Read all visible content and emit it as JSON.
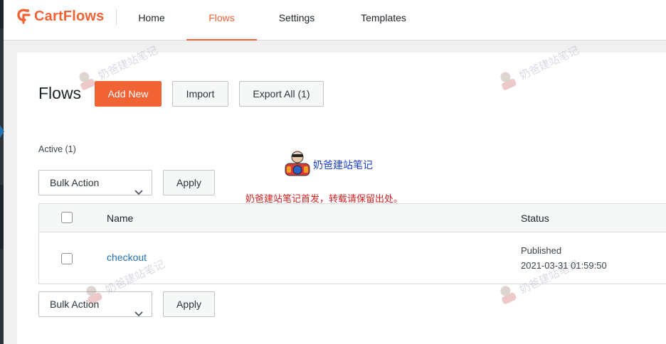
{
  "brand": {
    "name": "CartFlows",
    "color": "#f16334"
  },
  "nav": {
    "tabs": [
      {
        "label": "Home"
      },
      {
        "label": "Flows",
        "active": true
      },
      {
        "label": "Settings"
      },
      {
        "label": "Templates"
      }
    ]
  },
  "page": {
    "title": "Flows",
    "add_new_label": "Add New",
    "import_label": "Import",
    "export_label": "Export All (1)",
    "active_count_label": "Active (1)"
  },
  "bulk": {
    "selected_action": "Bulk Action",
    "apply_label": "Apply"
  },
  "table": {
    "columns": [
      "Name",
      "Status"
    ],
    "rows": [
      {
        "name": "checkout",
        "status": "Published",
        "date": "2021-03-31 01:59:50"
      }
    ]
  },
  "overlay": {
    "watermark_text": "奶爸建站笔记",
    "badge_text": "奶爸建站笔记",
    "notice_text": "奶爸建站笔记首发，转载请保留出处。"
  },
  "icons": {
    "logo": "cartflows-logo-icon",
    "dropdown": "chevron-down-icon",
    "mascot": "mascot-icon"
  }
}
